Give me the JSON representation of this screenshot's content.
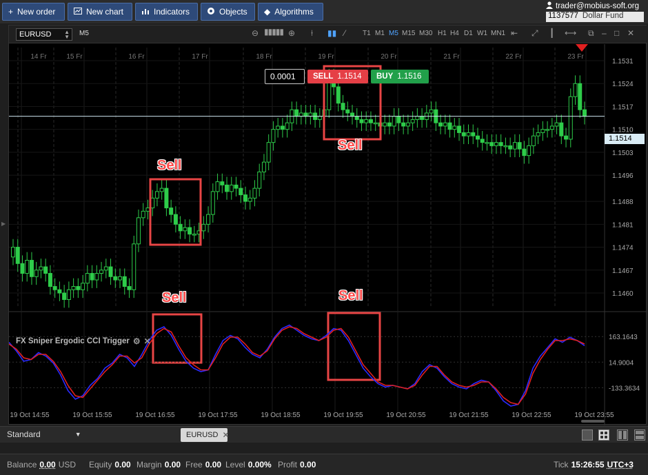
{
  "toolbar": {
    "new_order": "New order",
    "new_chart": "New chart",
    "indicators": "Indicators",
    "objects": "Objects",
    "algorithms": "Algorithms"
  },
  "account": {
    "user": "trader@mobius-soft.org",
    "number": "1137577",
    "fund": "Dollar Fund"
  },
  "chart_header": {
    "symbol": "EURUSD",
    "period": "M5",
    "timeframes": [
      "T1",
      "M1",
      "M5",
      "M15",
      "M30",
      "H1",
      "H4",
      "D1",
      "W1",
      "MN1"
    ],
    "active_timeframe": "M5"
  },
  "trade_widget": {
    "step": "0.0001",
    "sell_label": "SELL",
    "sell_price": "1.1514",
    "buy_label": "BUY",
    "buy_price": "1.1516"
  },
  "annotations": {
    "sell1": "Sell",
    "sell2": "Sell",
    "sell3": "Sell",
    "sell4": "Sell"
  },
  "indicator": {
    "title": "FX Sniper Ergodic CCI Trigger",
    "levels": [
      "163.1643",
      "14.9004",
      "-133.3634"
    ]
  },
  "current_price": "1.1514",
  "chart_data": [
    {
      "type": "candlestick",
      "title": "EURUSD M5",
      "price_axis_ticks": [
        "1.1531",
        "1.1524",
        "1.1517",
        "1.1510",
        "1.1503",
        "1.1496",
        "1.1488",
        "1.1481",
        "1.1474",
        "1.1467",
        "1.1460"
      ],
      "day_labels": [
        "14 Fr",
        "15 Fr",
        "16 Fr",
        "17 Fr",
        "18 Fr",
        "19 Fr",
        "20 Fr",
        "21 Fr",
        "22 Fr",
        "23 Fr"
      ],
      "time_labels": [
        "19 Oct 14:55",
        "19 Oct 15:55",
        "19 Oct 16:55",
        "19 Oct 17:55",
        "19 Oct 18:55",
        "19 Oct 19:55",
        "19 Oct 20:55",
        "19 Oct 21:55",
        "19 Oct 22:55",
        "19 Oct 23:55"
      ],
      "ylim": [
        1.1456,
        1.1535
      ],
      "closes": [
        1.1474,
        1.1469,
        1.1466,
        1.147,
        1.1465,
        1.1467,
        1.1468,
        1.1466,
        1.1462,
        1.1461,
        1.146,
        1.1458,
        1.1461,
        1.1462,
        1.1461,
        1.1463,
        1.1466,
        1.1464,
        1.1466,
        1.1467,
        1.1468,
        1.1465,
        1.1464,
        1.1465,
        1.1462,
        1.1461,
        1.1475,
        1.1483,
        1.1485,
        1.1486,
        1.1489,
        1.1491,
        1.1492,
        1.1486,
        1.1484,
        1.1481,
        1.1479,
        1.148,
        1.1478,
        1.1478,
        1.1479,
        1.1481,
        1.1484,
        1.1491,
        1.1494,
        1.1493,
        1.1491,
        1.1493,
        1.1492,
        1.149,
        1.1488,
        1.1489,
        1.1492,
        1.1497,
        1.15,
        1.1506,
        1.151,
        1.1511,
        1.151,
        1.1512,
        1.1516,
        1.1514,
        1.1515,
        1.1514,
        1.1515,
        1.1513,
        1.1514,
        1.1516,
        1.1526,
        1.1523,
        1.1518,
        1.1516,
        1.1515,
        1.1514,
        1.1513,
        1.1512,
        1.1513,
        1.1512,
        1.1512,
        1.1511,
        1.1512,
        1.1511,
        1.1514,
        1.1512,
        1.1511,
        1.1512,
        1.1513,
        1.1514,
        1.1513,
        1.1515,
        1.1516,
        1.1512,
        1.1511,
        1.1512,
        1.151,
        1.1511,
        1.1509,
        1.1508,
        1.1509,
        1.1508,
        1.1507,
        1.1506,
        1.1506,
        1.1505,
        1.1506,
        1.1505,
        1.1505,
        1.1504,
        1.1506,
        1.1504,
        1.1502,
        1.1505,
        1.1508,
        1.1509,
        1.151,
        1.151,
        1.1511,
        1.1512,
        1.1508,
        1.1507,
        1.152,
        1.1524,
        1.1516,
        1.1514
      ],
      "ma_line": 1.1514
    },
    {
      "type": "line",
      "title": "FX Sniper Ergodic CCI Trigger",
      "ylim": [
        -260,
        260
      ],
      "series": [
        {
          "color": "#2a2aff",
          "values": [
            130,
            80,
            20,
            30,
            70,
            50,
            10,
            -60,
            -150,
            -200,
            -180,
            -120,
            -80,
            -20,
            10,
            60,
            40,
            -10,
            60,
            140,
            200,
            220,
            170,
            90,
            20,
            -20,
            -40,
            -30,
            60,
            140,
            170,
            150,
            100,
            60,
            40,
            90,
            160,
            210,
            230,
            200,
            170,
            150,
            140,
            170,
            210,
            200,
            140,
            60,
            -20,
            -70,
            -110,
            -130,
            -120,
            -130,
            -140,
            -110,
            -40,
            0,
            -20,
            -70,
            -110,
            -130,
            -140,
            -110,
            -90,
            -100,
            -150,
            -210,
            -240,
            -230,
            -150,
            -20,
            50,
            100,
            150,
            130,
            160,
            140,
            110
          ]
        },
        {
          "color": "#e02020",
          "values": [
            120,
            90,
            40,
            30,
            60,
            60,
            20,
            -40,
            -120,
            -180,
            -190,
            -140,
            -90,
            -40,
            0,
            50,
            50,
            10,
            40,
            120,
            180,
            210,
            190,
            110,
            40,
            0,
            -30,
            -30,
            40,
            120,
            160,
            160,
            120,
            70,
            50,
            80,
            150,
            200,
            220,
            210,
            180,
            160,
            140,
            160,
            200,
            210,
            160,
            80,
            0,
            -50,
            -100,
            -120,
            -120,
            -130,
            -140,
            -120,
            -60,
            -10,
            -10,
            -60,
            -100,
            -120,
            -130,
            -120,
            -100,
            -100,
            -140,
            -190,
            -220,
            -230,
            -170,
            -50,
            30,
            90,
            140,
            140,
            150,
            140,
            120
          ]
        }
      ]
    }
  ],
  "tabs": {
    "workspace": "Standard",
    "active_tab": "EURUSD"
  },
  "status": {
    "balance_label": "Balance",
    "balance": "0.00",
    "currency": "USD",
    "equity_label": "Equity",
    "equity": "0.00",
    "margin_label": "Margin",
    "margin": "0.00",
    "free_label": "Free",
    "free": "0.00",
    "level_label": "Level",
    "level": "0.00%",
    "profit_label": "Profit",
    "profit": "0.00",
    "tick_label": "Tick",
    "time": "15:26:55",
    "tz": "UTC+3"
  }
}
